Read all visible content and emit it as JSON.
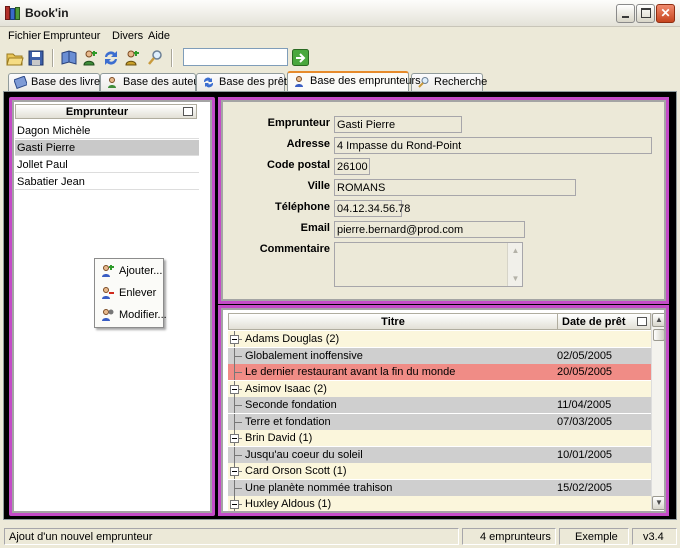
{
  "window": {
    "title": "Book'in"
  },
  "menu": [
    "Fichier",
    "Emprunteur",
    "Divers",
    "Aide"
  ],
  "toolbar": {
    "search_value": ""
  },
  "tabs": [
    {
      "label": "Base des livres",
      "active": false
    },
    {
      "label": "Base des auteurs",
      "active": false
    },
    {
      "label": "Base des prêts",
      "active": false
    },
    {
      "label": "Base des emprunteurs",
      "active": true
    },
    {
      "label": "Recherche",
      "active": false
    }
  ],
  "borrowers": {
    "header": "Emprunteur",
    "items": [
      "Dagon Michèle",
      "Gasti Pierre",
      "Jollet Paul",
      "Sabatier Jean"
    ],
    "selected": "Gasti Pierre"
  },
  "context_menu": [
    "Ajouter...",
    "Enlever",
    "Modifier..."
  ],
  "form": {
    "labels": {
      "emprunteur": "Emprunteur",
      "adresse": "Adresse",
      "code_postal": "Code postal",
      "ville": "Ville",
      "telephone": "Téléphone",
      "email": "Email",
      "commentaire": "Commentaire"
    },
    "values": {
      "emprunteur": "Gasti Pierre",
      "adresse": "4 Impasse du Rond-Point",
      "code_postal": "26100",
      "ville": "ROMANS",
      "telephone": "04.12.34.56.78",
      "email": "pierre.bernard@prod.com",
      "commentaire": ""
    }
  },
  "loans": {
    "headers": {
      "title": "Titre",
      "date": "Date de prêt"
    },
    "rows": [
      {
        "kind": "group",
        "title": "Adams Douglas (2)",
        "date": ""
      },
      {
        "kind": "book",
        "title": "Globalement inoffensive",
        "date": "02/05/2005"
      },
      {
        "kind": "book-late",
        "title": "Le dernier restaurant avant la fin du monde",
        "date": "20/05/2005"
      },
      {
        "kind": "group",
        "title": "Asimov Isaac (2)",
        "date": ""
      },
      {
        "kind": "book",
        "title": "Seconde fondation",
        "date": "11/04/2005"
      },
      {
        "kind": "book",
        "title": "Terre et fondation",
        "date": "07/03/2005"
      },
      {
        "kind": "group",
        "title": "Brin David (1)",
        "date": ""
      },
      {
        "kind": "book",
        "title": "Jusqu'au coeur du soleil",
        "date": "10/01/2005"
      },
      {
        "kind": "group",
        "title": "Card Orson Scott (1)",
        "date": ""
      },
      {
        "kind": "book",
        "title": "Une planète nommée trahison",
        "date": "15/02/2005"
      },
      {
        "kind": "group",
        "title": "Huxley Aldous (1)",
        "date": ""
      }
    ]
  },
  "status": {
    "message": "Ajout d'un nouvel emprunteur",
    "count": "4 emprunteurs",
    "base": "Exemple",
    "version": "v3.4"
  },
  "colors": {
    "accent": "#c44bc7",
    "late": "#f08c86",
    "tab_active": "#e68b2c"
  }
}
